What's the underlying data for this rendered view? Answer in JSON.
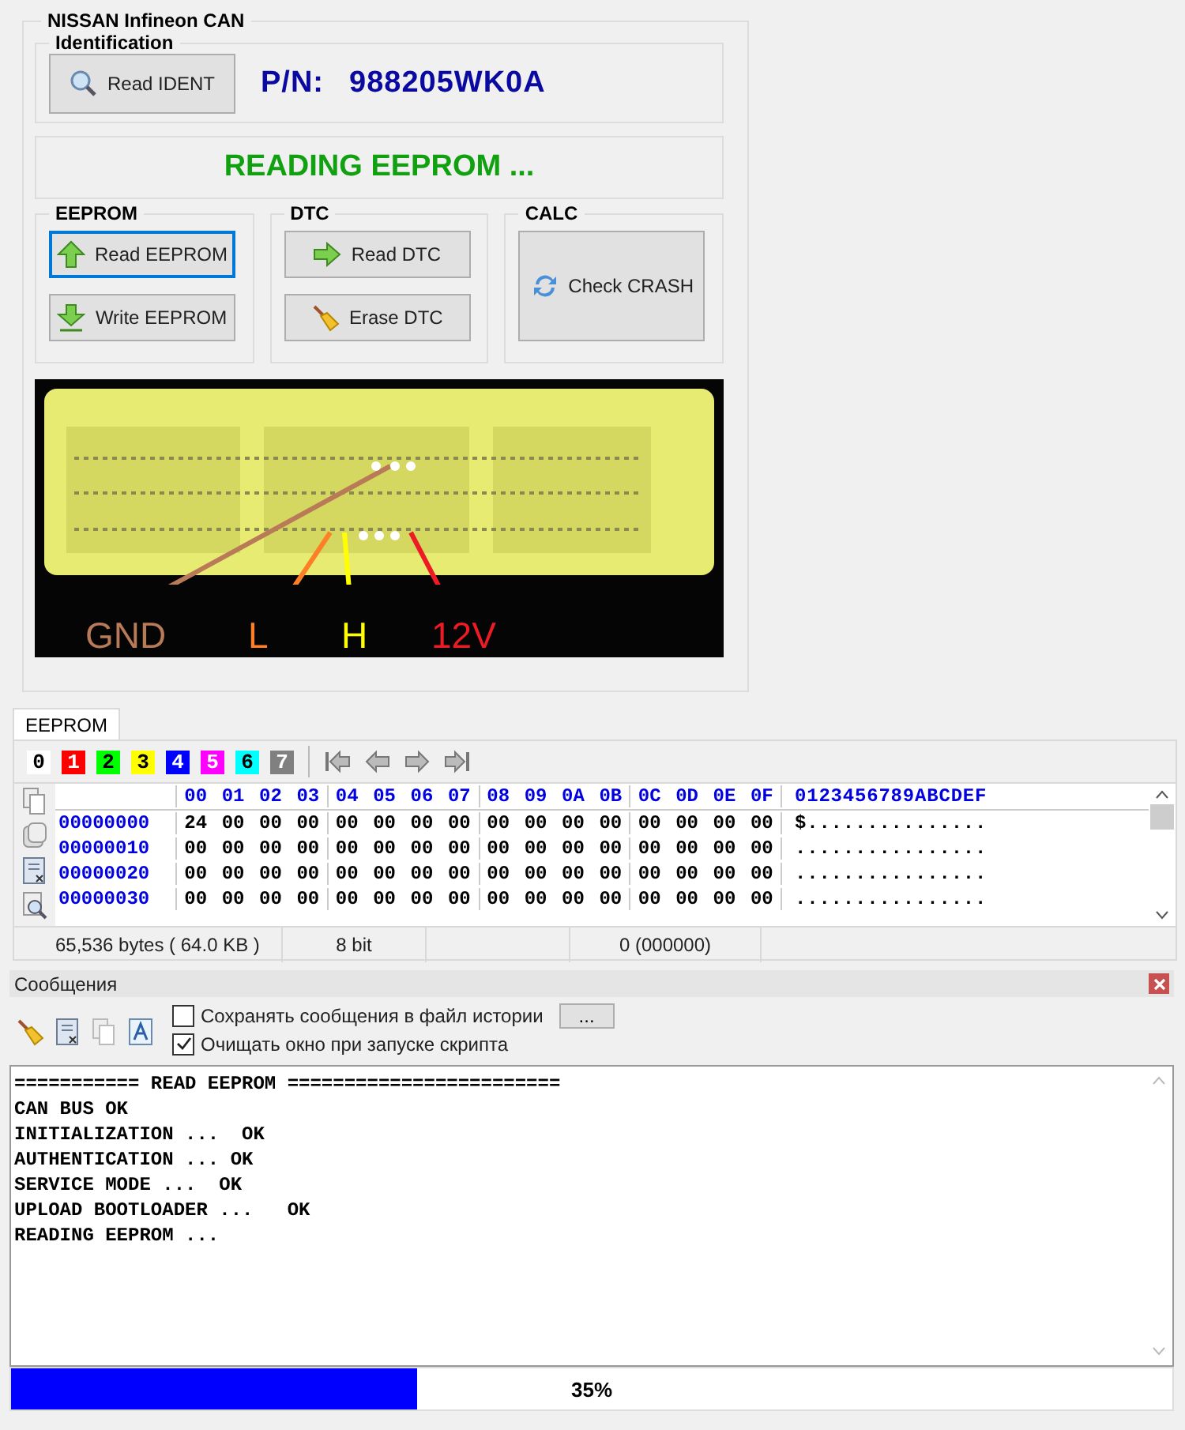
{
  "module": {
    "title": "NISSAN Infineon CAN",
    "identification": {
      "title": "Identification",
      "button": "Read IDENT",
      "pn_label": "P/N:",
      "pn_value": "988205WK0A"
    },
    "status": "READING EEPROM ...",
    "groups": [
      {
        "title": "EEPROM",
        "buttons": [
          {
            "label": "Read  EEPROM",
            "kind": "up",
            "focused": true
          },
          {
            "label": "Write  EEPROM",
            "kind": "down",
            "focused": false
          }
        ]
      },
      {
        "title": "DTC",
        "buttons": [
          {
            "label": "Read  DTC",
            "kind": "right",
            "focused": false
          },
          {
            "label": "Erase  DTC",
            "kind": "broom",
            "focused": false
          }
        ]
      },
      {
        "title": "CALC",
        "buttons": [
          {
            "label": "Check CRASH",
            "kind": "refresh",
            "focused": false
          }
        ]
      }
    ],
    "connector_image": {
      "labels": [
        {
          "text": "GND",
          "color": "#b97a57"
        },
        {
          "text": "L",
          "color": "#ff7f27"
        },
        {
          "text": "H",
          "color": "#ffff00"
        },
        {
          "text": "12V",
          "color": "#ed1c24"
        }
      ]
    }
  },
  "hex_editor": {
    "tab": {
      "label": "EEPROM",
      "selected": true
    },
    "color_swatches": [
      {
        "label": "0",
        "color": "#ffffff"
      },
      {
        "label": "1",
        "color": "#ff0000"
      },
      {
        "label": "2",
        "color": "#00ff00"
      },
      {
        "label": "3",
        "color": "#ffff00"
      },
      {
        "label": "4",
        "color": "#0000ff"
      },
      {
        "label": "5",
        "color": "#ff00ff"
      },
      {
        "label": "6",
        "color": "#00ffff"
      },
      {
        "label": "7",
        "color": "#808080"
      }
    ],
    "columns": [
      "00",
      "01",
      "02",
      "03",
      "04",
      "05",
      "06",
      "07",
      "08",
      "09",
      "0A",
      "0B",
      "0C",
      "0D",
      "0E",
      "0F"
    ],
    "ascii_header": "0123456789ABCDEF",
    "rows": [
      {
        "address": "00000000",
        "bytes": [
          "24",
          "00",
          "00",
          "00",
          "00",
          "00",
          "00",
          "00",
          "00",
          "00",
          "00",
          "00",
          "00",
          "00",
          "00",
          "00"
        ],
        "ascii": "$..............."
      },
      {
        "address": "00000010",
        "bytes": [
          "00",
          "00",
          "00",
          "00",
          "00",
          "00",
          "00",
          "00",
          "00",
          "00",
          "00",
          "00",
          "00",
          "00",
          "00",
          "00"
        ],
        "ascii": "................"
      },
      {
        "address": "00000020",
        "bytes": [
          "00",
          "00",
          "00",
          "00",
          "00",
          "00",
          "00",
          "00",
          "00",
          "00",
          "00",
          "00",
          "00",
          "00",
          "00",
          "00"
        ],
        "ascii": "................"
      },
      {
        "address": "00000030",
        "bytes": [
          "00",
          "00",
          "00",
          "00",
          "00",
          "00",
          "00",
          "00",
          "00",
          "00",
          "00",
          "00",
          "00",
          "00",
          "00",
          "00"
        ],
        "ascii": "................"
      }
    ],
    "status_bar": [
      "65,536 bytes ( 64.0 KB )",
      "8 bit",
      "0 (000000)"
    ]
  },
  "messages": {
    "title": "Сообщения",
    "options": [
      {
        "label": "Сохранять сообщения в файл истории",
        "checked": false,
        "button": "..."
      },
      {
        "label": "Очищать окно при запуске скрипта",
        "checked": true
      }
    ],
    "log": [
      "=========== READ EEPROM ========================",
      "CAN BUS OK",
      "INITIALIZATION ...  OK",
      "AUTHENTICATION ... OK",
      "SERVICE MODE ...  OK",
      "UPLOAD BOOTLOADER ...   OK",
      "READING EEPROM ..."
    ],
    "progress": {
      "level": 0.35,
      "reading": "35%"
    }
  }
}
